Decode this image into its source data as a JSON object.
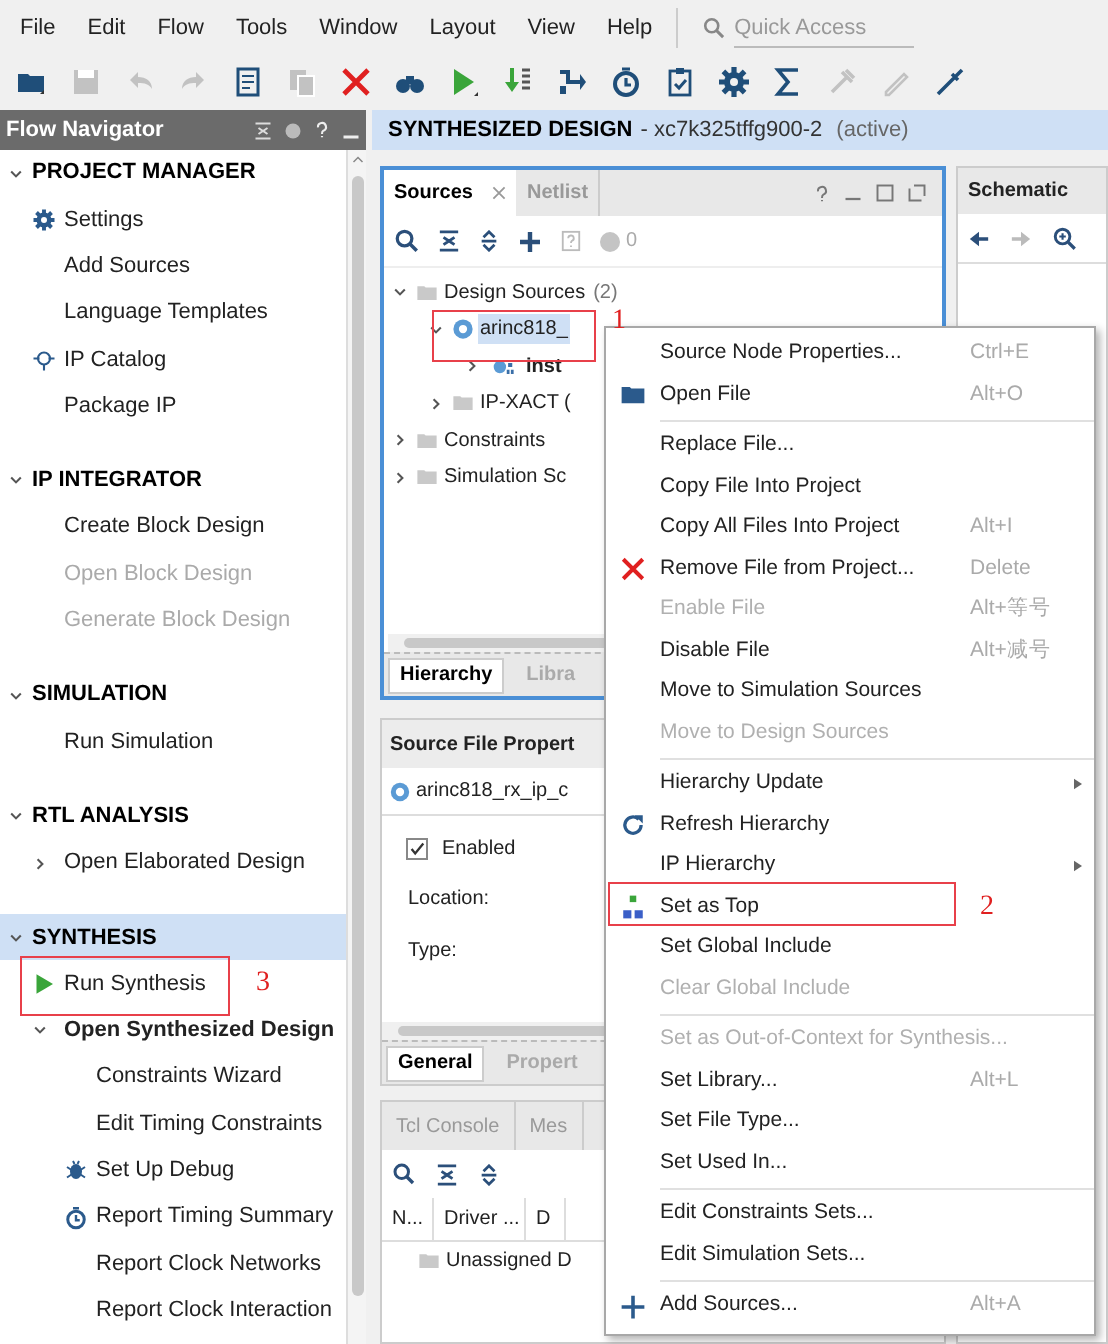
{
  "menu_bar": [
    {
      "label": "File"
    },
    {
      "label": "Edit"
    },
    {
      "label": "Flow"
    },
    {
      "label": "Tools"
    },
    {
      "label": "Window"
    },
    {
      "label": "Layout"
    },
    {
      "label": "View"
    },
    {
      "label": "Help"
    }
  ],
  "quick_access": {
    "placeholder": "Quick Access"
  },
  "toolbar": [
    {
      "kind": "open",
      "disabled": false
    },
    {
      "kind": "save",
      "disabled": true
    },
    {
      "kind": "undo",
      "disabled": true
    },
    {
      "kind": "redo",
      "disabled": true
    },
    {
      "kind": "report",
      "disabled": false
    },
    {
      "kind": "copy",
      "disabled": true
    },
    {
      "kind": "cancel",
      "disabled": false
    },
    {
      "kind": "binoculars",
      "disabled": false
    },
    {
      "kind": "run",
      "disabled": false
    },
    {
      "kind": "program",
      "disabled": false
    },
    {
      "kind": "step",
      "disabled": false
    },
    {
      "kind": "timer",
      "disabled": false
    },
    {
      "kind": "checklist",
      "disabled": false
    },
    {
      "kind": "settings",
      "disabled": false
    },
    {
      "kind": "sigma",
      "disabled": false
    },
    {
      "kind": "tool",
      "disabled": true
    },
    {
      "kind": "pencil",
      "disabled": true
    },
    {
      "kind": "notool",
      "disabled": false
    }
  ],
  "flow_navigator": {
    "title": "Flow Navigator",
    "sections": [
      {
        "label": "PROJECT MANAGER",
        "expanded": true,
        "selected": false,
        "items": [
          {
            "label": "Settings",
            "kind": "gear",
            "disabled": false
          },
          {
            "label": "Add Sources",
            "kind": "plain",
            "disabled": false
          },
          {
            "label": "Language Templates",
            "kind": "plain",
            "disabled": false
          },
          {
            "label": "IP Catalog",
            "kind": "ip",
            "disabled": false
          },
          {
            "label": "Package IP",
            "kind": "plain",
            "disabled": false
          }
        ]
      },
      {
        "label": "IP INTEGRATOR",
        "expanded": true,
        "selected": false,
        "items": [
          {
            "label": "Create Block Design",
            "kind": "plain",
            "disabled": false
          },
          {
            "label": "Open Block Design",
            "kind": "plain",
            "disabled": true
          },
          {
            "label": "Generate Block Design",
            "kind": "plain",
            "disabled": true
          }
        ]
      },
      {
        "label": "SIMULATION",
        "expanded": true,
        "selected": false,
        "items": [
          {
            "label": "Run Simulation",
            "kind": "plain",
            "disabled": false
          }
        ]
      },
      {
        "label": "RTL ANALYSIS",
        "expanded": true,
        "selected": false,
        "items": [
          {
            "label": "Open Elaborated Design",
            "kind": "group",
            "disabled": false,
            "expanded": false
          }
        ]
      },
      {
        "label": "SYNTHESIS",
        "expanded": true,
        "selected": true,
        "items": [
          {
            "label": "Run Synthesis",
            "kind": "run",
            "disabled": false
          },
          {
            "label": "Open Synthesized Design",
            "kind": "group",
            "disabled": false,
            "expanded": true,
            "children": [
              {
                "label": "Constraints Wizard",
                "kind": "plain",
                "disabled": false
              },
              {
                "label": "Edit Timing Constraints",
                "kind": "plain",
                "disabled": false
              },
              {
                "label": "Set Up Debug",
                "kind": "bug",
                "disabled": false
              },
              {
                "label": "Report Timing Summary",
                "kind": "timer",
                "disabled": false
              },
              {
                "label": "Report Clock Networks",
                "kind": "plain",
                "disabled": false
              },
              {
                "label": "Report Clock Interaction",
                "kind": "plain",
                "disabled": false
              }
            ]
          }
        ]
      }
    ]
  },
  "design_header": {
    "title": "SYNTHESIZED DESIGN",
    "part": "- xc7k325tffg900-2",
    "status": "(active)"
  },
  "sources_panel": {
    "tabs": [
      {
        "label": "Sources",
        "selected": true
      },
      {
        "label": "Netlist",
        "selected": false
      }
    ],
    "issue_count": "0",
    "tree": [
      {
        "label": "Design Sources",
        "count": "(2)",
        "kind": "folder",
        "expanded": true,
        "selected": false,
        "children": [
          {
            "label": "arinc818_",
            "kind": "verilog",
            "expanded": true,
            "selected": true,
            "children": [
              {
                "label": "inst",
                "kind": "ip",
                "expanded": false,
                "selected": false
              }
            ]
          },
          {
            "label": "IP-XACT (",
            "kind": "folder",
            "expanded": false,
            "selected": false
          }
        ]
      },
      {
        "label": "Constraints",
        "kind": "folder",
        "expanded": false,
        "selected": false
      },
      {
        "label": "Simulation Sc",
        "kind": "folder",
        "expanded": false,
        "selected": false
      }
    ],
    "bottom_tabs": [
      {
        "label": "Hierarchy",
        "selected": true
      },
      {
        "label": "Libra",
        "selected": false
      }
    ]
  },
  "schematic_panel": {
    "title": "Schematic"
  },
  "properties_panel": {
    "title": "Source File Propert",
    "file": "arinc818_rx_ip_c",
    "enabled": {
      "label": "Enabled",
      "checked": true
    },
    "fields": [
      {
        "label": "Location:"
      },
      {
        "label": "Type:"
      }
    ],
    "tabs": [
      {
        "label": "General",
        "selected": true
      },
      {
        "label": "Propert",
        "selected": false
      }
    ]
  },
  "tcl_panel": {
    "tabs": [
      {
        "label": "Tcl Console",
        "selected": false
      },
      {
        "label": "Mes",
        "selected": false
      }
    ],
    "columns": [
      "N...",
      "Driver ...",
      "D"
    ],
    "rows": [
      {
        "label": "Unassigned D"
      }
    ]
  },
  "context_menu": {
    "groups": [
      [
        {
          "label": "Source Node Properties...",
          "shortcut": "Ctrl+E",
          "kind": "plain",
          "disabled": false,
          "submenu": false
        },
        {
          "label": "Open File",
          "shortcut": "Alt+O",
          "kind": "folder",
          "disabled": false,
          "submenu": false
        }
      ],
      [
        {
          "label": "Replace File...",
          "kind": "plain",
          "disabled": false,
          "submenu": false
        },
        {
          "label": "Copy File Into Project",
          "kind": "plain",
          "disabled": false,
          "submenu": false
        },
        {
          "label": "Copy All Files Into Project",
          "shortcut": "Alt+I",
          "kind": "plain",
          "disabled": false,
          "submenu": false
        },
        {
          "label": "Remove File from Project...",
          "shortcut": "Delete",
          "kind": "remove",
          "disabled": false,
          "submenu": false
        },
        {
          "label": "Enable File",
          "shortcut": "Alt+等号",
          "kind": "plain",
          "disabled": true,
          "submenu": false
        },
        {
          "label": "Disable File",
          "shortcut": "Alt+减号",
          "kind": "plain",
          "disabled": false,
          "submenu": false
        },
        {
          "label": "Move to Simulation Sources",
          "kind": "plain",
          "disabled": false,
          "submenu": false
        },
        {
          "label": "Move to Design Sources",
          "kind": "plain",
          "disabled": true,
          "submenu": false
        }
      ],
      [
        {
          "label": "Hierarchy Update",
          "kind": "plain",
          "disabled": false,
          "submenu": true
        },
        {
          "label": "Refresh Hierarchy",
          "kind": "refresh",
          "disabled": false,
          "submenu": false
        },
        {
          "label": "IP Hierarchy",
          "kind": "plain",
          "disabled": false,
          "submenu": true
        },
        {
          "label": "Set as Top",
          "kind": "top",
          "disabled": false,
          "submenu": false
        },
        {
          "label": "Set Global Include",
          "kind": "plain",
          "disabled": false,
          "submenu": false
        },
        {
          "label": "Clear Global Include",
          "kind": "plain",
          "disabled": true,
          "submenu": false
        }
      ],
      [
        {
          "label": "Set as Out-of-Context for Synthesis...",
          "kind": "plain",
          "disabled": true,
          "submenu": false
        },
        {
          "label": "Set Library...",
          "shortcut": "Alt+L",
          "kind": "plain",
          "disabled": false,
          "submenu": false
        },
        {
          "label": "Set File Type...",
          "kind": "plain",
          "disabled": false,
          "submenu": false
        },
        {
          "label": "Set Used In...",
          "kind": "plain",
          "disabled": false,
          "submenu": false
        }
      ],
      [
        {
          "label": "Edit Constraints Sets...",
          "kind": "plain",
          "disabled": false,
          "submenu": false
        },
        {
          "label": "Edit Simulation Sets...",
          "kind": "plain",
          "disabled": false,
          "submenu": false
        }
      ],
      [
        {
          "label": "Add Sources...",
          "shortcut": "Alt+A",
          "kind": "add",
          "disabled": false,
          "submenu": false
        }
      ]
    ]
  },
  "annotations": [
    {
      "label": "1"
    },
    {
      "label": "2"
    },
    {
      "label": "3"
    }
  ]
}
